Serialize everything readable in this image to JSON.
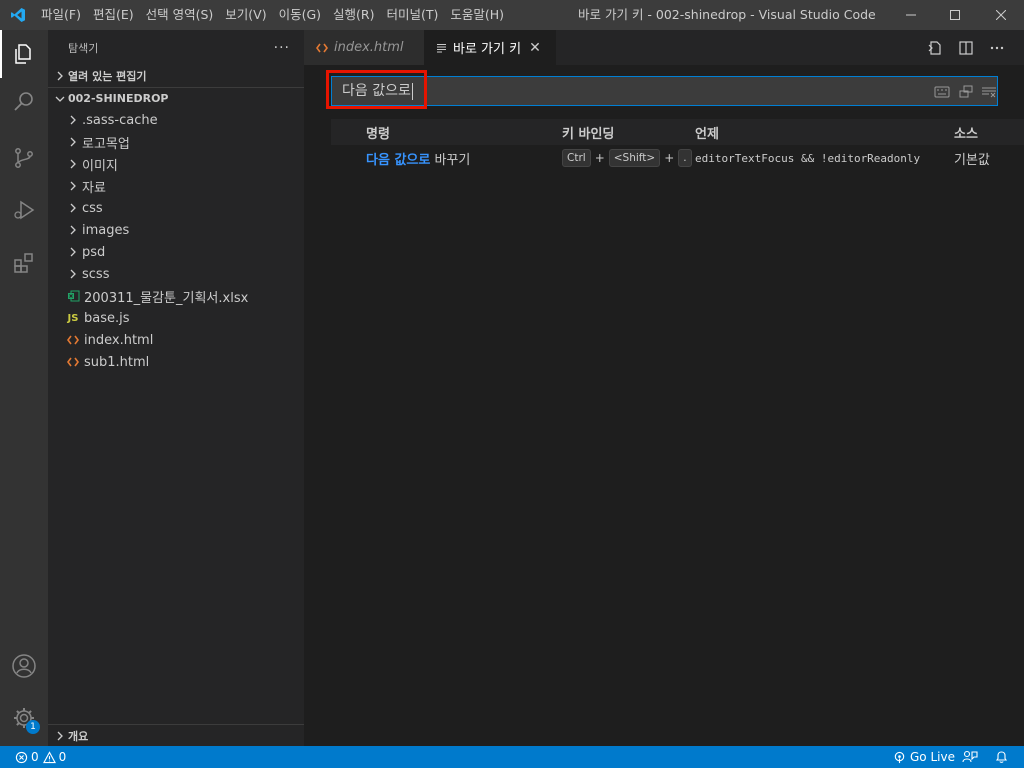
{
  "titlebar": {
    "menu": [
      "파일(F)",
      "편집(E)",
      "선택 영역(S)",
      "보기(V)",
      "이동(G)",
      "실행(R)",
      "터미널(T)",
      "도움말(H)"
    ],
    "window_title": "바로 가기 키 - 002-shinedrop - Visual Studio Code [관리..."
  },
  "activitybar": {
    "items": [
      "explorer-icon",
      "search-icon",
      "source-control-icon",
      "run-debug-icon",
      "extensions-icon"
    ],
    "bottom": [
      "account-icon",
      "settings-gear-icon"
    ],
    "settings_badge": "1"
  },
  "sidebar": {
    "title": "탐색기",
    "more": "···",
    "open_editors_label": "열려 있는 편집기",
    "project_label": "002-SHINEDROP",
    "folders": [
      ".sass-cache",
      "로고목업",
      "이미지",
      "자료",
      "css",
      "images",
      "psd",
      "scss"
    ],
    "files": [
      {
        "name": "200311_물감툰_기획서.xlsx",
        "icon": "excel-icon",
        "color": "#21a366"
      },
      {
        "name": "base.js",
        "icon": "js-icon",
        "color": "#cbcb41"
      },
      {
        "name": "index.html",
        "icon": "html-icon",
        "color": "#e37933"
      },
      {
        "name": "sub1.html",
        "icon": "html-icon",
        "color": "#e37933"
      }
    ],
    "outline_label": "개요"
  },
  "tabs": [
    {
      "label": "index.html",
      "icon": "html-icon",
      "active": false
    },
    {
      "label": "바로 가기 키",
      "icon": "keybindings-icon",
      "active": true
    }
  ],
  "keybindings": {
    "search_value": "다음 값으로",
    "columns": [
      "명령",
      "키 바인딩",
      "언제",
      "소스"
    ],
    "row": {
      "command_highlight": "다음 값으로",
      "command_rest": " 바꾸기",
      "keys": [
        "Ctrl",
        "<Shift>",
        "."
      ],
      "key_separator": "+",
      "when": "editorTextFocus && !editorReadonly",
      "source": "기본값"
    }
  },
  "statusbar": {
    "errors": "0",
    "warnings": "0",
    "go_live": "Go Live"
  },
  "colors": {
    "accent": "#007acc",
    "highlight": "#3794ff",
    "annotation": "#e51400"
  }
}
